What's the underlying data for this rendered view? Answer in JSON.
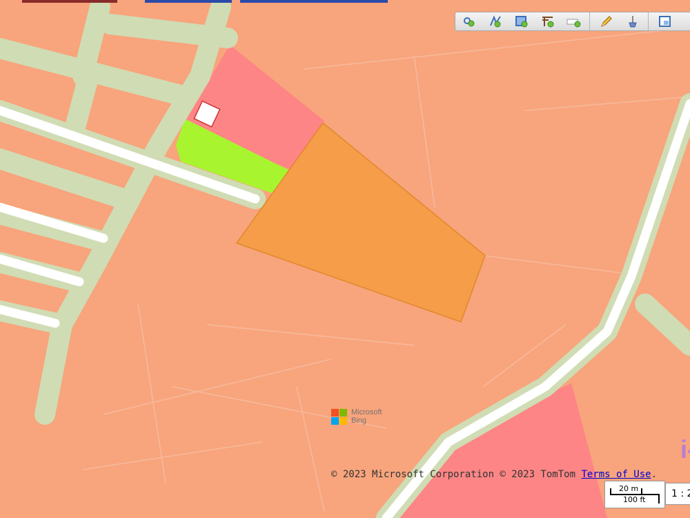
{
  "map": {
    "type": "zoning-parcel-map",
    "colors": {
      "background_zone": "#f8a47c",
      "road_border": "#d0dcb4",
      "road_fill": "#ffffff",
      "pink_zone": "#fd8585",
      "green_parcel": "#a8f52f",
      "selected_parcel_fill": "#f59d48",
      "selected_parcel_stroke": "#e0882a",
      "parcel_lines": "#f7b697"
    }
  },
  "toolbar": {
    "tools": [
      {
        "name": "draw-point-icon"
      },
      {
        "name": "draw-line-icon"
      },
      {
        "name": "draw-polygon-icon"
      },
      {
        "name": "draw-table-icon"
      },
      {
        "name": "draw-label-icon"
      },
      {
        "name": "edit-pencil-icon"
      },
      {
        "name": "erase-icon"
      },
      {
        "name": "window-icon"
      }
    ]
  },
  "attribution": {
    "logo_brand": "Microsoft",
    "logo_product": "Bing",
    "logo_colors": [
      "#f25022",
      "#7fba00",
      "#00a4ef",
      "#ffb900"
    ],
    "copyright_text": "© 2023 Microsoft Corporation © 2023 TomTom ",
    "terms_link": "Terms of Use",
    "terms_suffix": "."
  },
  "scale": {
    "metric": "20 m",
    "imperial": "100 ft",
    "ratio": "1 : 2"
  },
  "edge_mark": "i-"
}
